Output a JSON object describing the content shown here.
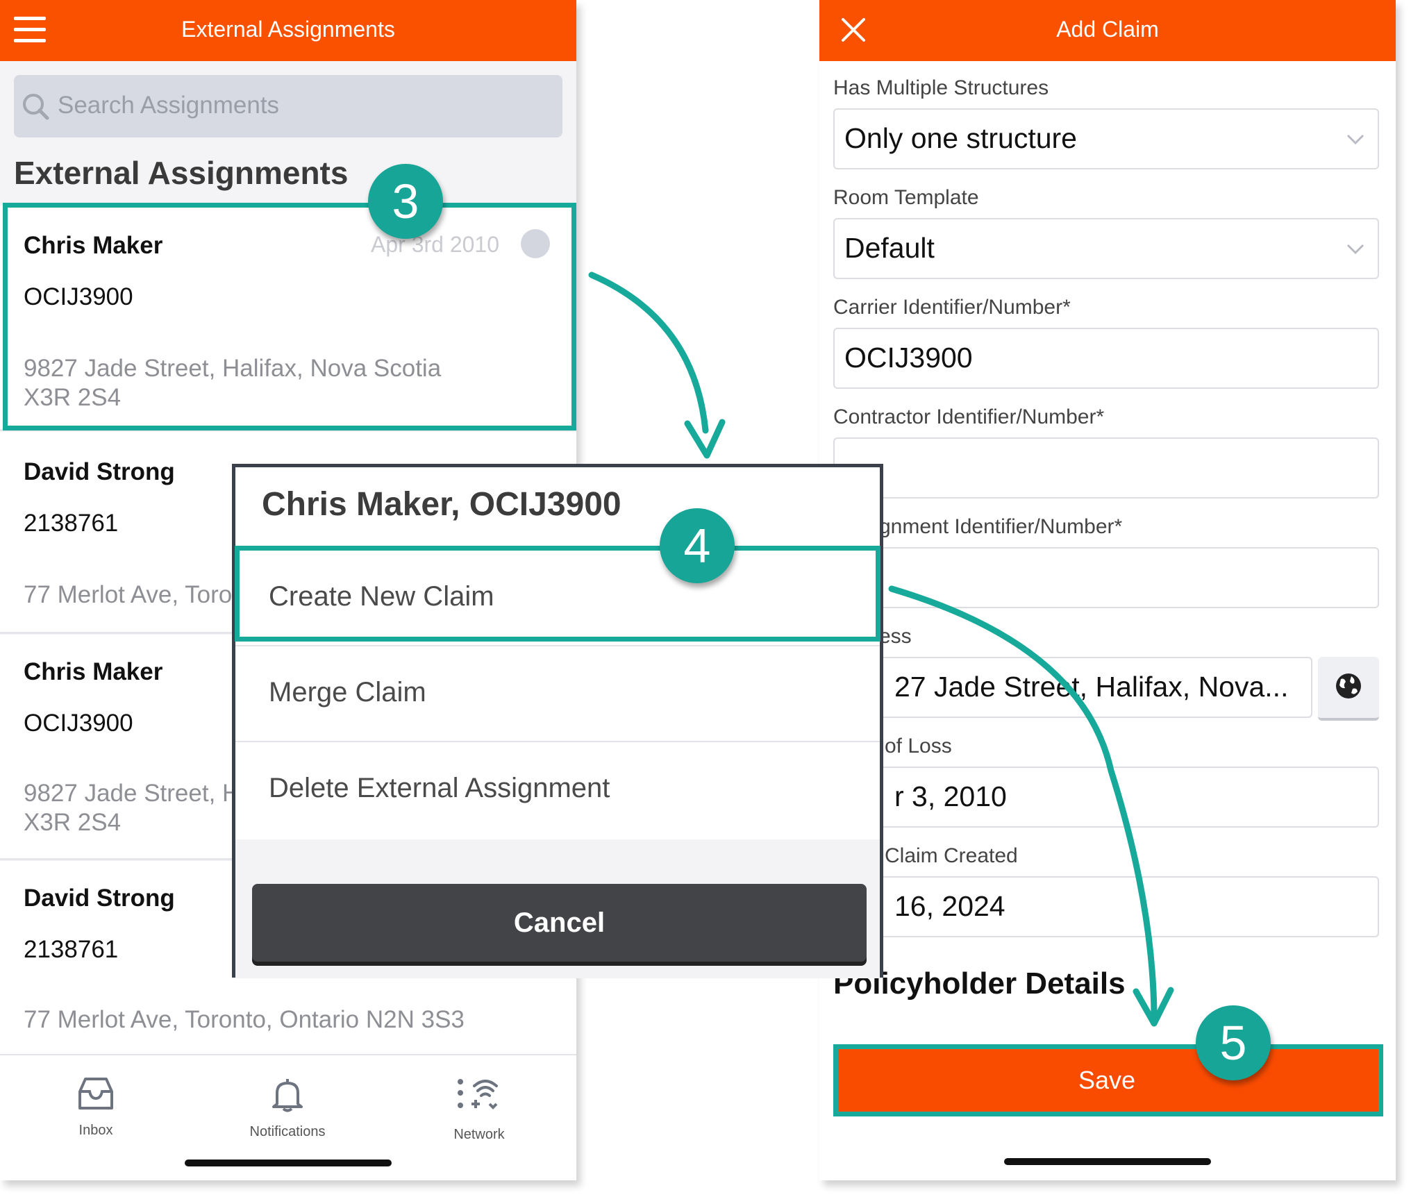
{
  "left_screen": {
    "header_title": "External Assignments",
    "search_placeholder": "Search Assignments",
    "section_title": "External Assignments",
    "assignments": [
      {
        "name": "Chris Maker",
        "id": "OCIJ3900",
        "date": "Apr 3rd 2010",
        "address_line1": "9827 Jade Street, Halifax, Nova Scotia",
        "address_line2": "X3R 2S4"
      },
      {
        "name": "David Strong",
        "id": "2138761",
        "address_line1": "77 Merlot Ave, Toro"
      },
      {
        "name": "Chris Maker",
        "id": "OCIJ3900",
        "address_line1": "9827 Jade Street, H",
        "address_line2": "X3R 2S4"
      },
      {
        "name": "David Strong",
        "id": "2138761",
        "address_line1": "77 Merlot Ave, Toronto, Ontario N2N 3S3"
      }
    ],
    "tabs": [
      {
        "label": "Inbox",
        "icon": "inbox-icon"
      },
      {
        "label": "Notifications",
        "icon": "bell-icon"
      },
      {
        "label": "Network",
        "icon": "network-icon"
      }
    ]
  },
  "action_sheet": {
    "title": "Chris Maker, OCIJ3900",
    "items": [
      "Create New Claim",
      "Merge Claim",
      "Delete External Assignment"
    ],
    "cancel": "Cancel"
  },
  "right_screen": {
    "header_title": "Add Claim",
    "fields": [
      {
        "label": "Has Multiple Structures",
        "value": "Only one structure",
        "type": "select"
      },
      {
        "label": "Room Template",
        "value": "Default",
        "type": "select"
      },
      {
        "label": "Carrier Identifier/Number*",
        "value": "OCIJ3900",
        "type": "text"
      },
      {
        "label": "Contractor Identifier/Number*",
        "value": "",
        "type": "text"
      },
      {
        "label": "gnment Identifier/Number*",
        "value": "",
        "type": "text"
      },
      {
        "label": "ess",
        "value": "27 Jade Street, Halifax, Nova...",
        "type": "address"
      },
      {
        "label": "of Loss",
        "value": "r 3, 2010",
        "type": "text"
      },
      {
        "label": "Claim Created",
        "value": "16, 2024",
        "type": "text"
      }
    ],
    "section_title": "Policyholder Details",
    "save_label": "Save"
  },
  "callouts": {
    "step3": "3",
    "step4": "4",
    "step5": "5"
  },
  "colors": {
    "accent": "#fa5100",
    "highlight": "#17a99a"
  }
}
